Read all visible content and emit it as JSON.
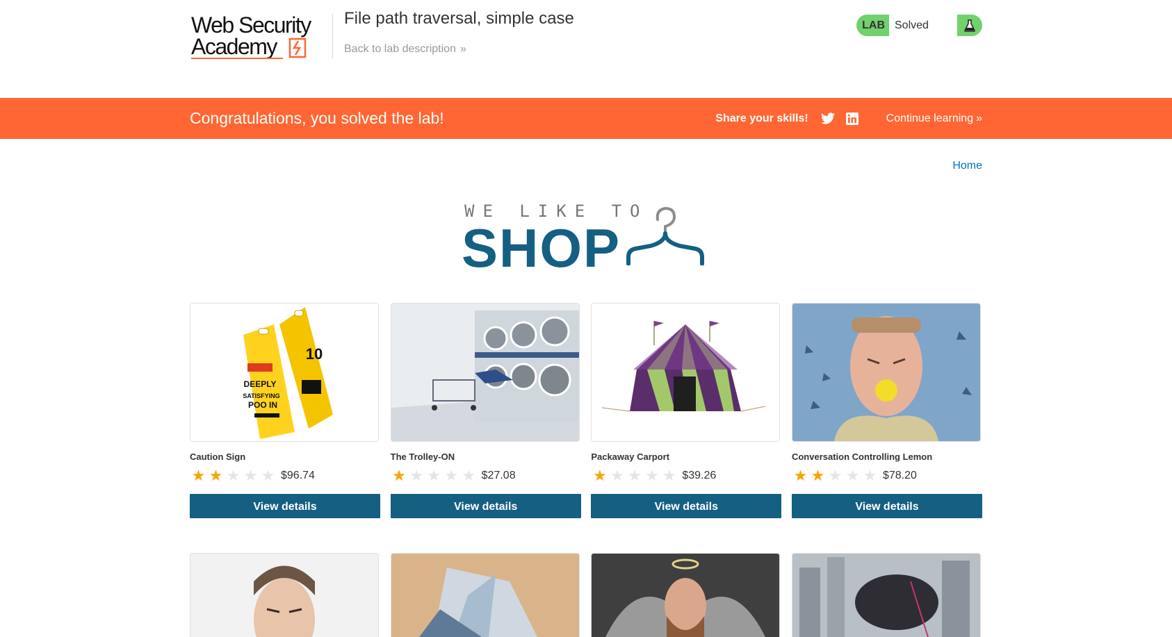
{
  "header": {
    "logo_text": "Web Security Academy",
    "lab_title": "File path traversal, simple case",
    "back_link": "Back to lab description",
    "lab_badge": "LAB",
    "lab_status": "Solved"
  },
  "banner": {
    "message": "Congratulations, you solved the lab!",
    "share_label": "Share your skills!",
    "continue_label": "Continue learning"
  },
  "nav": {
    "home": "Home"
  },
  "hero": {
    "line1": "WE LIKE TO",
    "line2": "SHOP"
  },
  "products": [
    {
      "name": "Caution Sign",
      "rating": 2,
      "price": "$96.74",
      "button": "View details"
    },
    {
      "name": "The Trolley-ON",
      "rating": 1,
      "price": "$27.08",
      "button": "View details"
    },
    {
      "name": "Packaway Carport",
      "rating": 1,
      "price": "$39.26",
      "button": "View details"
    },
    {
      "name": "Conversation Controlling Lemon",
      "rating": 2,
      "price": "$78.20",
      "button": "View details"
    }
  ],
  "colors": {
    "accent": "#ff6633",
    "primary": "#155f82",
    "status": "#70d16d",
    "link": "#0071bc",
    "star": "#f7a600"
  }
}
